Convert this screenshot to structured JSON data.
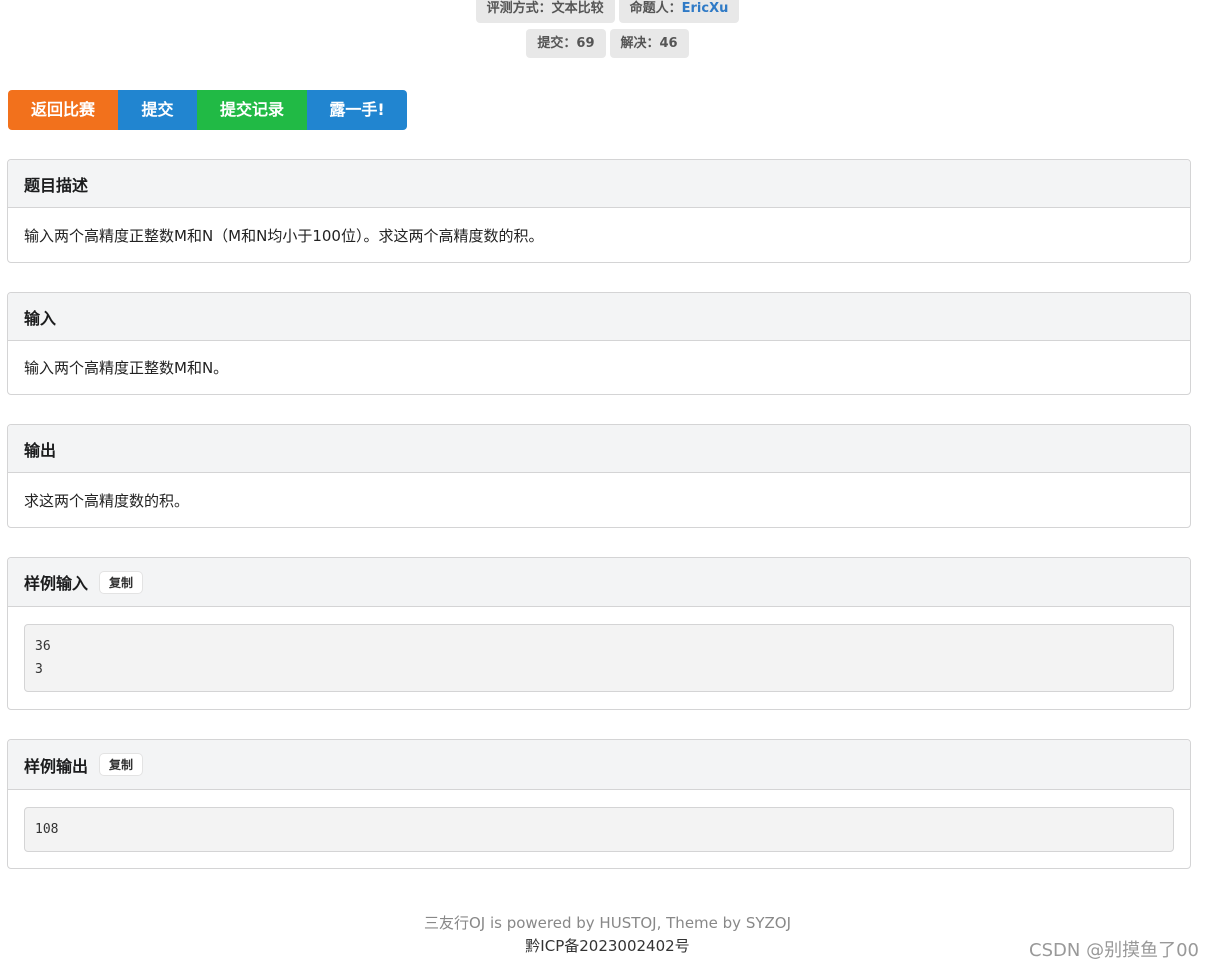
{
  "labels": {
    "judge_label": "评测方式：文本比较",
    "author_prefix": "命题人：",
    "author_name": "EricXu",
    "submit_count": "提交：69",
    "solved_count": "解决：46"
  },
  "buttons": {
    "back": "返回比赛",
    "submit": "提交",
    "records": "提交记录",
    "show": "露一手!"
  },
  "sections": {
    "description": {
      "title": "题目描述",
      "text": "输入两个高精度正整数M和N（M和N均小于100位）。求这两个高精度数的积。"
    },
    "input": {
      "title": "输入",
      "text": "输入两个高精度正整数M和N。"
    },
    "output": {
      "title": "输出",
      "text": "求这两个高精度数的积。"
    },
    "sample_input": {
      "title": "样例输入",
      "copy_label": "复制",
      "code": "36\n3"
    },
    "sample_output": {
      "title": "样例输出",
      "copy_label": "复制",
      "code": "108"
    }
  },
  "footer": {
    "powered": "三友行OJ is powered by HUSTOJ, Theme by SYZOJ",
    "icp": "黔ICP备2023002402号"
  },
  "watermark": "CSDN @别摸鱼了00",
  "colors": {
    "back_button": "#f2711c",
    "primary_button": "#2185d0",
    "records_button": "#21ba45",
    "link": "#2f7ac6"
  }
}
